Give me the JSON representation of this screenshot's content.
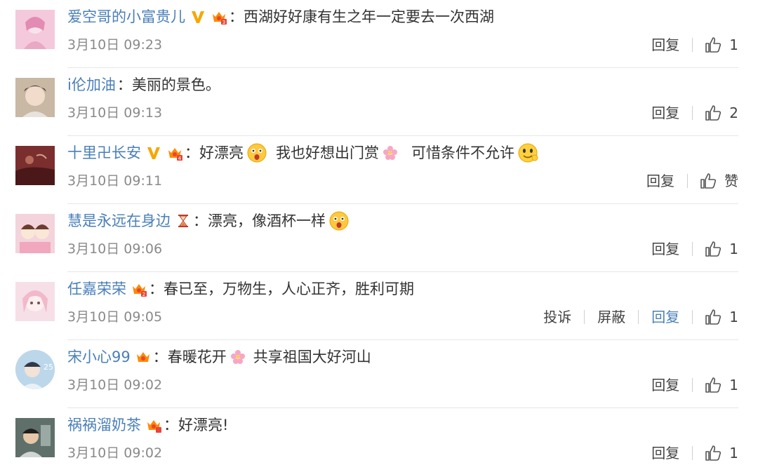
{
  "comments": [
    {
      "username": "爱空哥的小富贵儿",
      "verified": true,
      "level": "3",
      "text": "西湖好好康有生之年一定要去一次西湖",
      "timestamp": "3月10日 09:23",
      "reply_label": "回复",
      "like_count": "1",
      "avatar_color": "#f4c9dc"
    },
    {
      "username": "i伦加油",
      "verified": false,
      "text": "美丽的景色。",
      "timestamp": "3月10日 09:13",
      "reply_label": "回复",
      "like_count": "2",
      "avatar_color": "#c8b8a4"
    },
    {
      "username": "十里卍长安",
      "verified": true,
      "level": "4",
      "text_a": "好漂亮",
      "text_b": "我也好想出门赏",
      "text_c": "可惜条件不允许",
      "timestamp": "3月10日 09:11",
      "reply_label": "回复",
      "like_count": "赞",
      "avatar_color": "#7a2e2e"
    },
    {
      "username": "慧是永远在身边",
      "text_a": "漂亮，像酒杯一样",
      "timestamp": "3月10日 09:06",
      "reply_label": "回复",
      "like_count": "1",
      "avatar_color": "#f3d3dc"
    },
    {
      "username": "任嘉荣荣",
      "level": "2",
      "text": "春已至，万物生，人心正齐，胜利可期",
      "timestamp": "3月10日 09:05",
      "report_label": "投诉",
      "block_label": "屏蔽",
      "reply_label": "回复",
      "like_count": "1",
      "avatar_color": "#f6dfe7"
    },
    {
      "username": "宋小心99",
      "text_a": "春暖花开",
      "text_b": "共享祖国大好河山",
      "timestamp": "3月10日 09:02",
      "reply_label": "回复",
      "like_count": "1",
      "avatar_color": "#bcd7ea"
    },
    {
      "username": "祸祸溜奶茶",
      "text": "好漂亮!",
      "timestamp": "3月10日 09:02",
      "reply_label": "回复",
      "like_count": "1",
      "avatar_color": "#5f6f6a"
    }
  ],
  "colors": {
    "username": "#4a7fb8",
    "verified_v": "#f6a700",
    "badge_crown": "#ff8a00",
    "divider": "#e6e6e6"
  }
}
